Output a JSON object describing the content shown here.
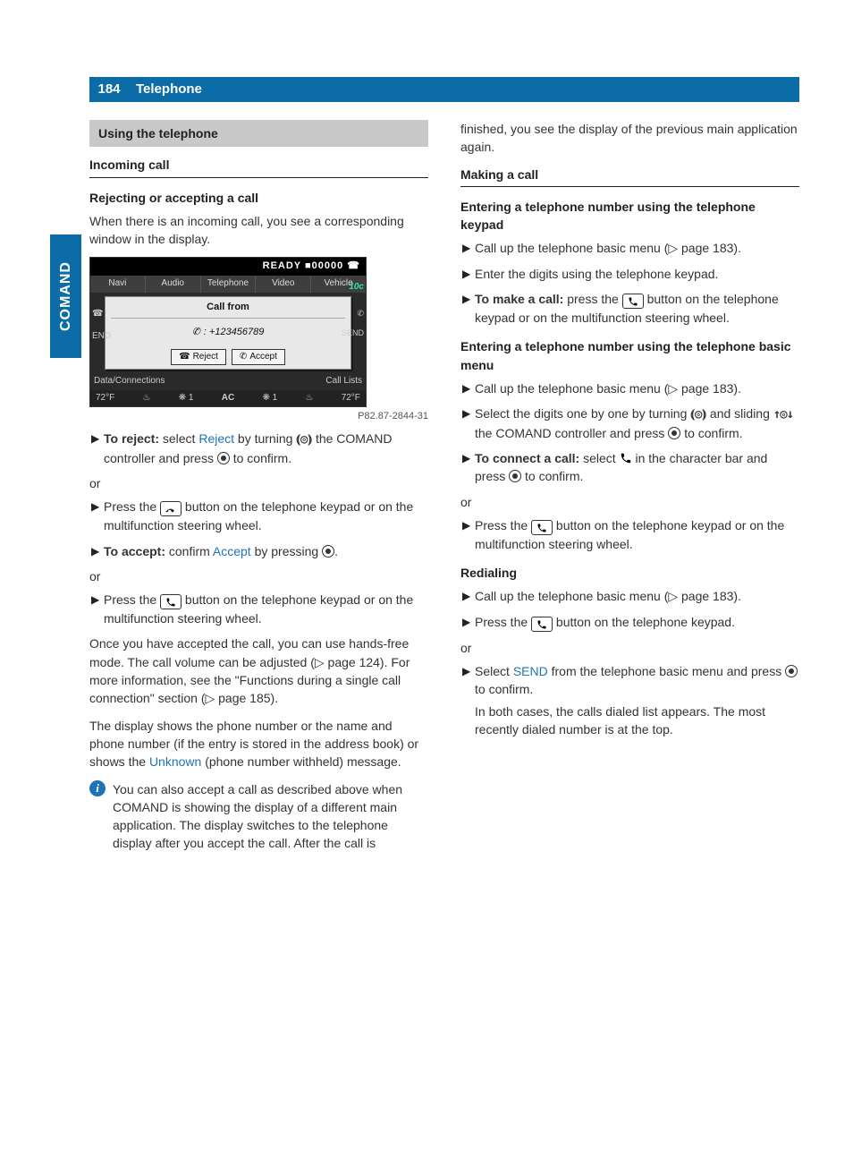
{
  "header": {
    "page_number": "184",
    "title": "Telephone"
  },
  "side_tab": "COMAND",
  "left": {
    "section_bar": "Using the telephone",
    "h2": "Incoming call",
    "h3": "Rejecting or accepting a call",
    "intro": "When there is an incoming call, you see a corresponding window in the display.",
    "figure": {
      "status": "READY ■00000 ☎",
      "tabs": [
        "Navi",
        "Audio",
        "Telephone",
        "Video",
        "Vehicle"
      ],
      "dialog_title": "Call from",
      "dialog_number": ": +123456789",
      "reject": "Reject",
      "accept": "Accept",
      "badge10c": "10c",
      "lower_left": "Data/Connections",
      "lower_right": "Call Lists",
      "footer_temp_l": "72°F",
      "footer_temp_r": "72°F",
      "footer_ac": "AC",
      "footer_fan1": "1",
      "footer_fan2": "1",
      "send": "SEND",
      "end": "END",
      "caption": "P82.87-2844-31"
    },
    "step_reject_1a": "To reject:",
    "step_reject_1b": " select ",
    "step_reject_1c": "Reject",
    "step_reject_1d": " by turning ",
    "step_reject_1e": " the COMAND controller and press ",
    "step_reject_1f": " to confirm.",
    "or": "or",
    "step_reject_2a": "Press the ",
    "step_reject_2b": " button on the telephone keypad or on the multifunction steering wheel.",
    "step_accept_1a": "To accept:",
    "step_accept_1b": " confirm ",
    "step_accept_1c": "Accept",
    "step_accept_1d": " by pressing ",
    "step_accept_1e": ".",
    "step_accept_2a": "Press the ",
    "step_accept_2b": " button on the telephone keypad or on the multifunction steering wheel.",
    "para_after": "Once you have accepted the call, you can use hands-free mode. The call volume can be adjusted (▷ page 124). For more information, see the \"Functions during a single call connection\" section (▷ page 185).",
    "para_display_a": "The display shows the phone number or the name and phone number (if the entry is stored in the address book) or shows the ",
    "para_display_b": "Unknown",
    "para_display_c": " (phone number withheld) message.",
    "info": "You can also accept a call as described above when COMAND is showing the display of a different main application. The display switches to the telephone display after you accept the call. After the call is"
  },
  "right": {
    "cont": "finished, you see the display of the previous main application again.",
    "h2": "Making a call",
    "h3a": "Entering a telephone number using the telephone keypad",
    "a1": "Call up the telephone basic menu (▷ page 183).",
    "a2": "Enter the digits using the telephone keypad.",
    "a3a": "To make a call:",
    "a3b": " press the ",
    "a3c": " button on the telephone keypad or on the multifunction steering wheel.",
    "h3b": "Entering a telephone number using the telephone basic menu",
    "b1": "Call up the telephone basic menu (▷ page 183).",
    "b2a": "Select the digits one by one by turning ",
    "b2b": " and sliding ",
    "b2c": " the COMAND controller and press ",
    "b2d": " to confirm.",
    "b3a": "To connect a call:",
    "b3b": " select ",
    "b3c": " in the character bar and press ",
    "b3d": " to confirm.",
    "or": "or",
    "b4a": "Press the ",
    "b4b": " button on the telephone keypad or on the multifunction steering wheel.",
    "h3c": "Redialing",
    "c1": "Call up the telephone basic menu (▷ page 183).",
    "c2a": "Press the ",
    "c2b": " button on the telephone keypad.",
    "c3a": "Select ",
    "c3b": "SEND",
    "c3c": " from the telephone basic menu and press ",
    "c3d": " to confirm.",
    "c3e": "In both cases, the calls dialed list appears. The most recently dialed number is at the top."
  },
  "glyphs": {
    "triangle": "▶",
    "turn": "⦅◎⦆",
    "slide": "↑◎↓",
    "info": "i"
  }
}
